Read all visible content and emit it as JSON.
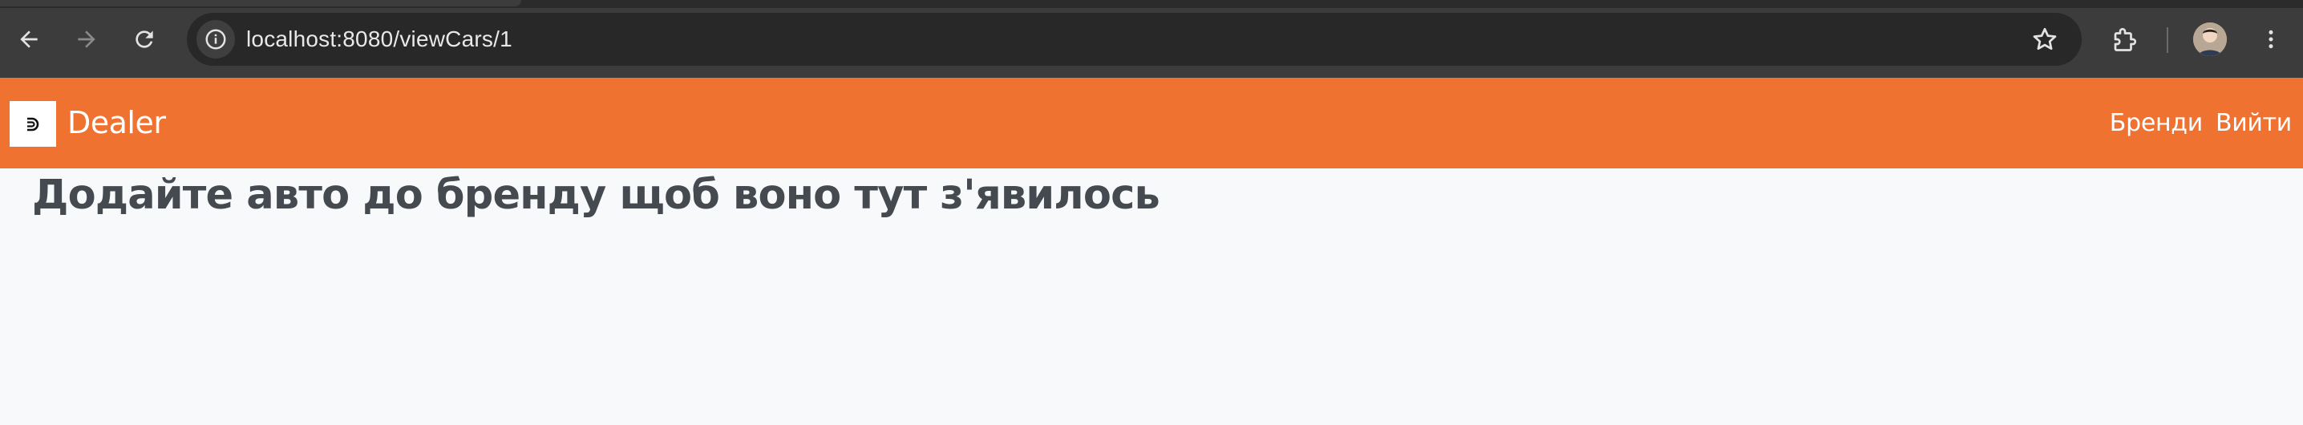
{
  "browser": {
    "url": "localhost:8080/viewCars/1",
    "icons": {
      "back": "arrow-left-icon",
      "forward": "arrow-right-icon",
      "reload": "reload-icon",
      "site_info": "info-icon",
      "bookmark": "star-icon",
      "extensions": "puzzle-icon",
      "profile": "avatar",
      "menu": "three-dots-vertical-icon"
    }
  },
  "navbar": {
    "brand": "Dealer",
    "links": [
      "Бренди",
      "Вийти"
    ],
    "color": "#ef7230"
  },
  "main": {
    "empty_message": "Додайте авто до бренду щоб воно тут з'явилось"
  }
}
